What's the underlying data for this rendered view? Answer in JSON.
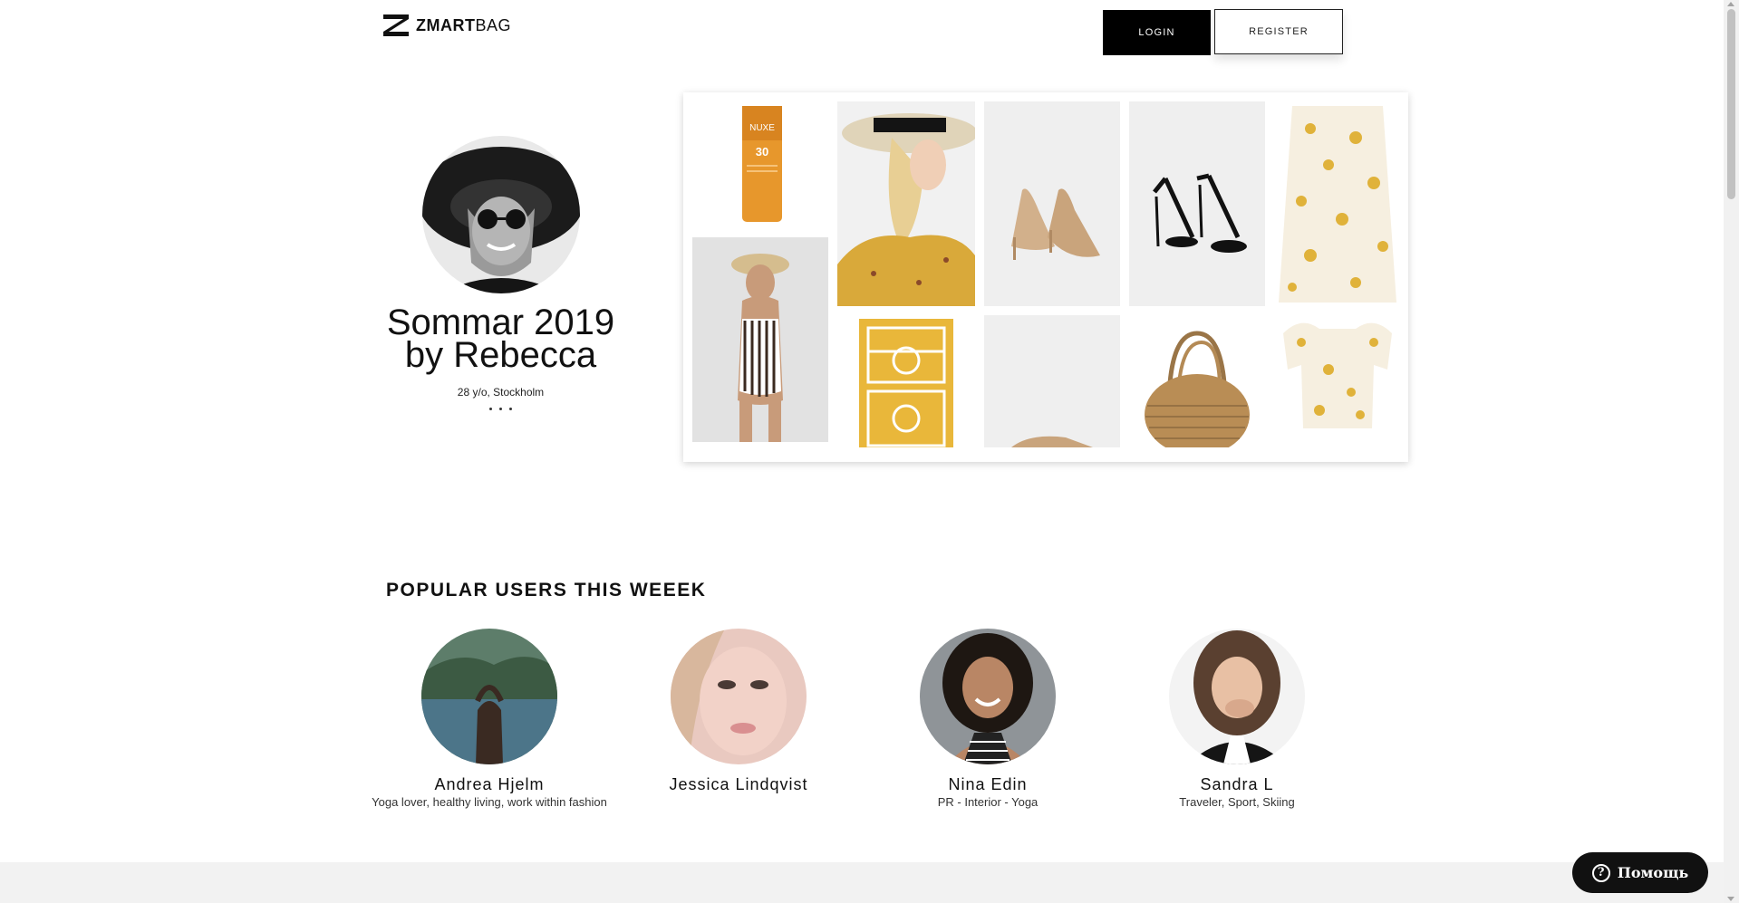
{
  "header": {
    "logo_bold": "ZMART",
    "logo_light": "BAG",
    "login_label": "LOGIN",
    "register_label": "REGISTER"
  },
  "profile": {
    "title_line1": "Sommar 2019",
    "title_line2": "by Rebecca",
    "subtitle": "28 y/o, Stockholm"
  },
  "products": [
    {
      "name": "sunscreen",
      "brand_text": "NUXE",
      "spf_text": "30"
    },
    {
      "name": "straw-hat-blouse"
    },
    {
      "name": "nude-heels"
    },
    {
      "name": "black-sandals"
    },
    {
      "name": "floral-skirt"
    },
    {
      "name": "striped-swimsuit"
    },
    {
      "name": "yellow-towel"
    },
    {
      "name": "shoe-partial"
    },
    {
      "name": "straw-basket-bag"
    },
    {
      "name": "floral-top"
    }
  ],
  "popular": {
    "title": "POPULAR USERS THIS WEEEK",
    "users": [
      {
        "name": "Andrea Hjelm",
        "bio": "Yoga lover, healthy living, work within fashion"
      },
      {
        "name": "Jessica Lindqvist",
        "bio": ""
      },
      {
        "name": "Nina Edin",
        "bio": "PR - Interior - Yoga"
      },
      {
        "name": "Sandra L",
        "bio": "Traveler, Sport, Skiing"
      }
    ]
  },
  "help": {
    "label": "Помощь"
  },
  "colors": {
    "accent_black": "#000000",
    "footer_band": "#f2f2f2"
  }
}
